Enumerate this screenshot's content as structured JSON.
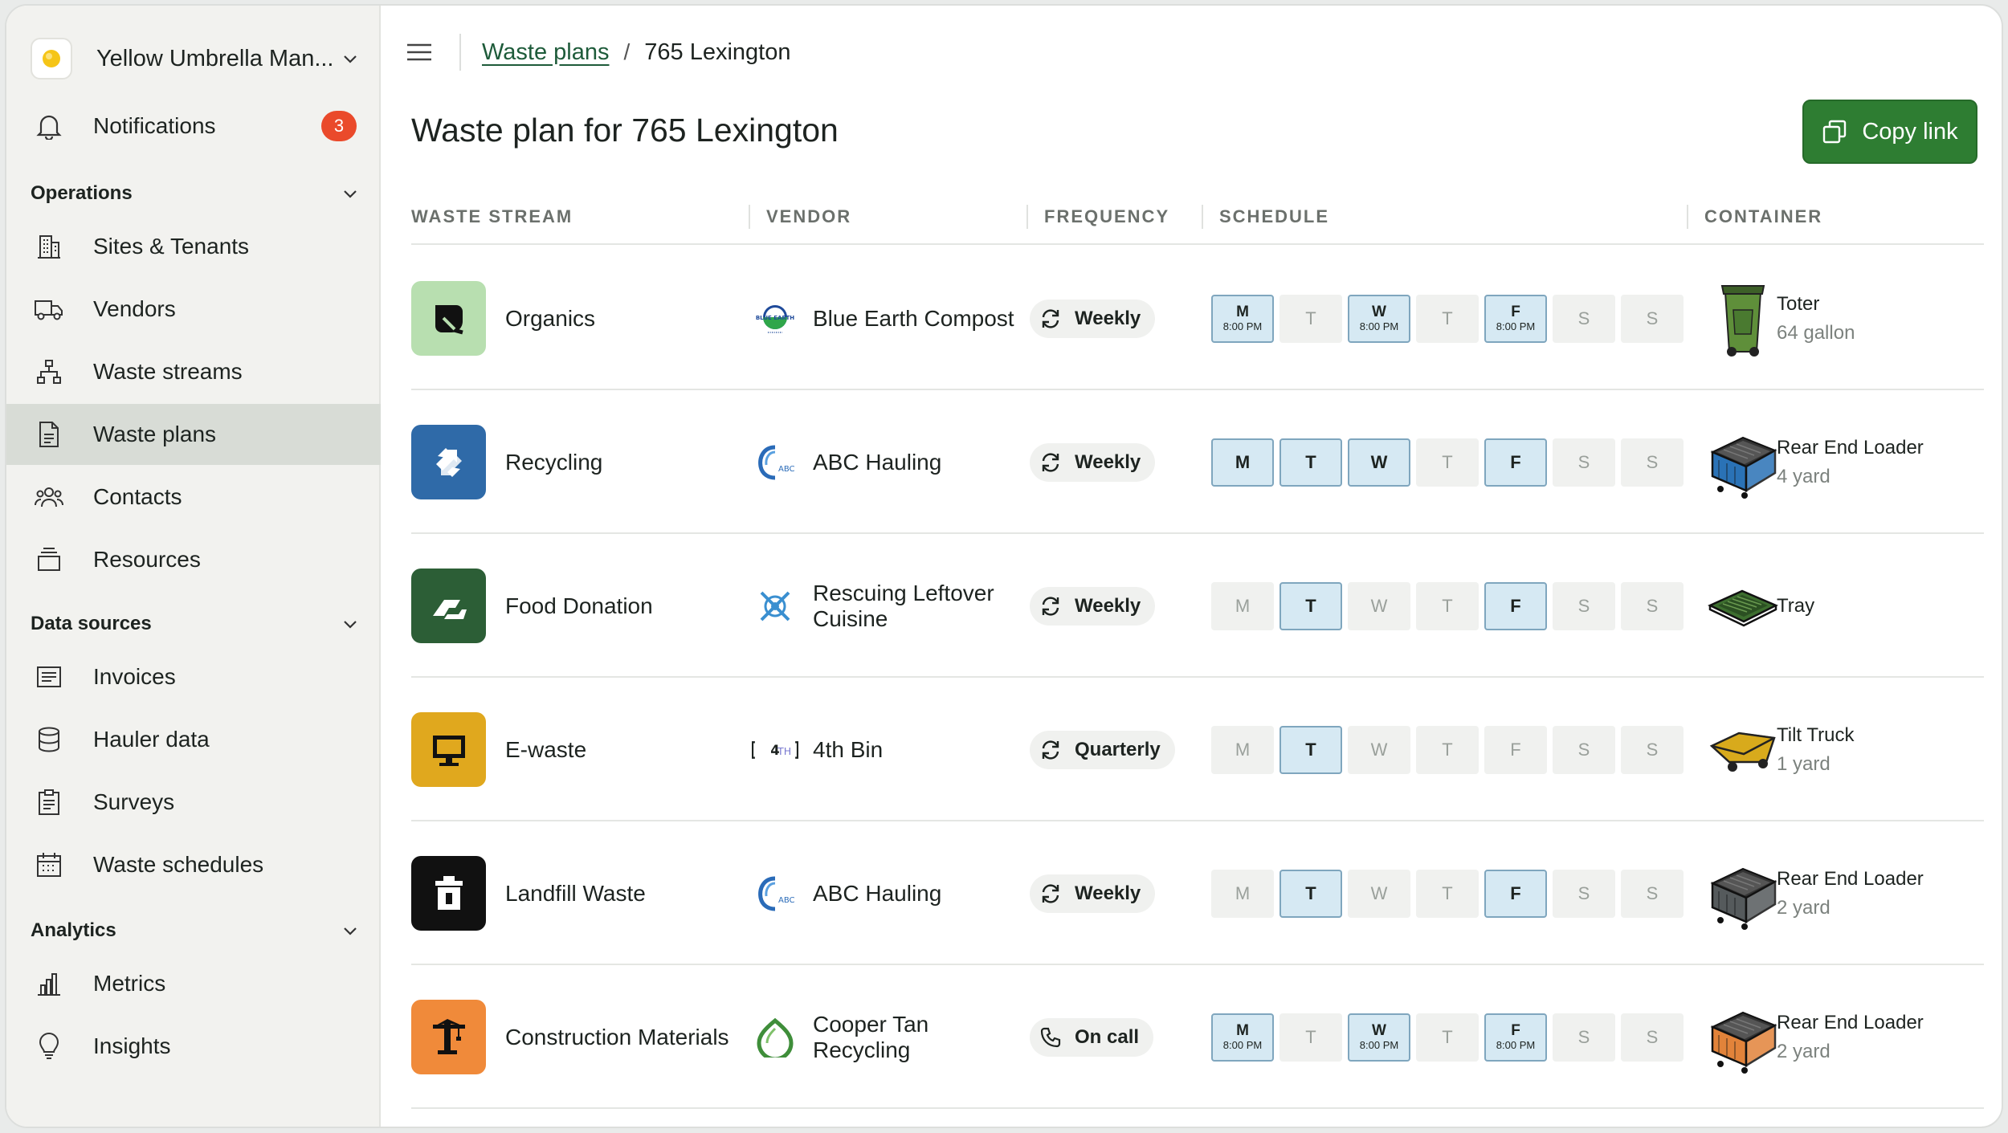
{
  "org": {
    "name": "Yellow Umbrella Man...",
    "logo_color": "#f5c518"
  },
  "sidebar": {
    "notifications": {
      "label": "Notifications",
      "count": "3"
    },
    "sections": [
      {
        "label": "Operations",
        "items": [
          {
            "label": "Sites & Tenants",
            "icon": "building-icon"
          },
          {
            "label": "Vendors",
            "icon": "truck-icon"
          },
          {
            "label": "Waste streams",
            "icon": "hierarchy-icon"
          },
          {
            "label": "Waste plans",
            "icon": "document-icon",
            "active": true
          },
          {
            "label": "Contacts",
            "icon": "people-icon"
          },
          {
            "label": "Resources",
            "icon": "stack-icon"
          }
        ]
      },
      {
        "label": "Data sources",
        "items": [
          {
            "label": "Invoices",
            "icon": "invoice-icon"
          },
          {
            "label": "Hauler data",
            "icon": "database-icon"
          },
          {
            "label": "Surveys",
            "icon": "clipboard-icon"
          },
          {
            "label": "Waste schedules",
            "icon": "calendar-icon"
          }
        ]
      },
      {
        "label": "Analytics",
        "items": [
          {
            "label": "Metrics",
            "icon": "bar-chart-icon"
          },
          {
            "label": "Insights",
            "icon": "lightbulb-icon"
          }
        ]
      }
    ]
  },
  "breadcrumb": {
    "parent": "Waste plans",
    "separator": "/",
    "current": "765 Lexington"
  },
  "page": {
    "title": "Waste plan for 765 Lexington",
    "copy_label": "Copy link",
    "accent": "#2e7d32"
  },
  "table": {
    "headers": [
      "WASTE STREAM",
      "VENDOR",
      "FREQUENCY",
      "SCHEDULE",
      "CONTAINER"
    ],
    "days": [
      "M",
      "T",
      "W",
      "T",
      "F",
      "S",
      "S"
    ],
    "rows": [
      {
        "stream": "Organics",
        "stream_icon": "leaf-icon",
        "stream_color": "#b8dfb0",
        "vendor": "Blue Earth Compost",
        "vendor_icon": "blue-earth-logo-icon",
        "frequency": "Weekly",
        "freq_icon": "repeat-icon",
        "schedule": [
          true,
          false,
          true,
          false,
          true,
          false,
          false
        ],
        "times": [
          "8:00 PM",
          "",
          "8:00 PM",
          "",
          "8:00 PM",
          "",
          ""
        ],
        "container": "Toter",
        "size": "64 gallon",
        "container_icon": "toter-icon",
        "container_color": "#5f8f3a"
      },
      {
        "stream": "Recycling",
        "stream_icon": "recycle-icon",
        "stream_color": "#2f6aa8",
        "vendor": "ABC Hauling",
        "vendor_icon": "abc-hauling-logo-icon",
        "frequency": "Weekly",
        "freq_icon": "repeat-icon",
        "schedule": [
          true,
          true,
          true,
          false,
          true,
          false,
          false
        ],
        "times": [
          "",
          "",
          "",
          "",
          "",
          "",
          ""
        ],
        "container": "Rear End Loader",
        "size": "4 yard",
        "container_icon": "dumpster-icon",
        "container_color": "#2a72b6"
      },
      {
        "stream": "Food Donation",
        "stream_icon": "hand-icon",
        "stream_color": "#2c5e36",
        "vendor": "Rescuing Leftover Cuisine",
        "vendor_icon": "rlc-logo-icon",
        "frequency": "Weekly",
        "freq_icon": "repeat-icon",
        "schedule": [
          false,
          true,
          false,
          false,
          true,
          false,
          false
        ],
        "times": [
          "",
          "",
          "",
          "",
          "",
          "",
          ""
        ],
        "container": "Tray",
        "size": "",
        "container_icon": "tray-icon",
        "container_color": "#3d6e2f"
      },
      {
        "stream": "E-waste",
        "stream_icon": "monitor-icon",
        "stream_color": "#e0a81e",
        "vendor": "4th Bin",
        "vendor_icon": "4th-bin-logo-icon",
        "frequency": "Quarterly",
        "freq_icon": "repeat-icon",
        "schedule": [
          false,
          true,
          false,
          false,
          false,
          false,
          false
        ],
        "times": [
          "",
          "",
          "",
          "",
          "",
          "",
          ""
        ],
        "container": "Tilt Truck",
        "size": "1 yard",
        "container_icon": "tilt-truck-icon",
        "container_color": "#d8aa1c"
      },
      {
        "stream": "Landfill Waste",
        "stream_icon": "trash-icon",
        "stream_color": "#111111",
        "vendor": "ABC Hauling",
        "vendor_icon": "abc-hauling-logo-icon",
        "frequency": "Weekly",
        "freq_icon": "repeat-icon",
        "schedule": [
          false,
          true,
          false,
          false,
          true,
          false,
          false
        ],
        "times": [
          "",
          "",
          "",
          "",
          "",
          "",
          ""
        ],
        "container": "Rear End Loader",
        "size": "2 yard",
        "container_icon": "dumpster-icon",
        "container_color": "#555a5c"
      },
      {
        "stream": "Construction Materials",
        "stream_icon": "crane-icon",
        "stream_color": "#f08a3a",
        "vendor": "Cooper Tan Recycling",
        "vendor_icon": "cooper-tan-logo-icon",
        "frequency": "On call",
        "freq_icon": "phone-icon",
        "schedule": [
          true,
          false,
          true,
          false,
          true,
          false,
          false
        ],
        "times": [
          "8:00 PM",
          "",
          "8:00 PM",
          "",
          "8:00 PM",
          "",
          ""
        ],
        "container": "Rear End Loader",
        "size": "2 yard",
        "container_icon": "dumpster-icon",
        "container_color": "#e2833a"
      }
    ]
  }
}
